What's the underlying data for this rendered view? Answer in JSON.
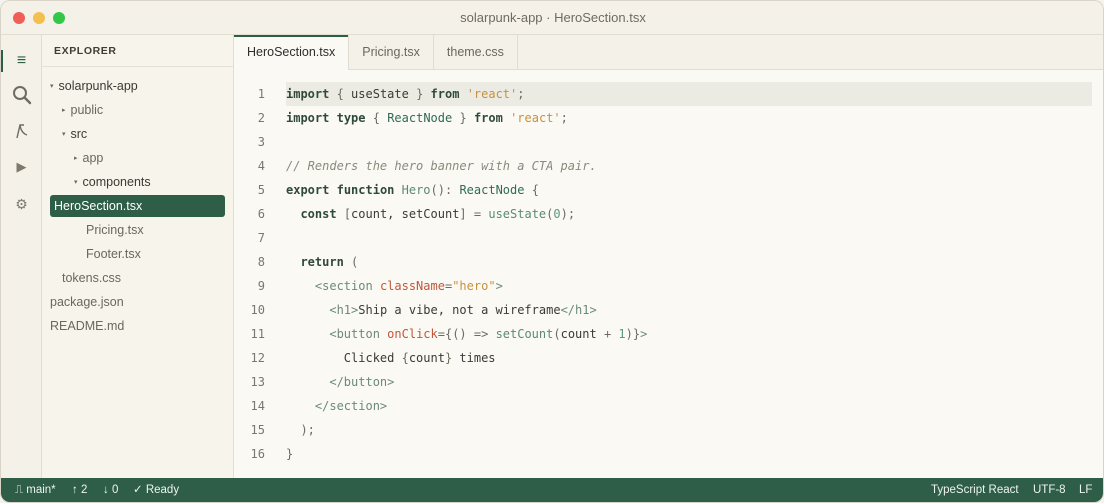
{
  "window": {
    "title": "solarpunk-app · HeroSection.tsx"
  },
  "activity_bar": {
    "icons": [
      {
        "name": "explorer-icon",
        "glyph": "≡",
        "active": true
      },
      {
        "name": "search-icon",
        "glyph": "🔍",
        "active": false
      },
      {
        "name": "source-control-icon",
        "glyph": "⎍",
        "active": false
      },
      {
        "name": "run-icon",
        "glyph": "▶",
        "active": false
      },
      {
        "name": "settings-icon",
        "glyph": "⚙",
        "active": false
      }
    ]
  },
  "sidebar": {
    "header": "EXPLORER",
    "items": [
      {
        "label": "solarpunk-app",
        "caret": "▾"
      },
      {
        "label": "public",
        "caret": "▸"
      },
      {
        "label": "src",
        "caret": "▾"
      },
      {
        "label": "app",
        "caret": "▸"
      },
      {
        "label": "components",
        "caret": "▾"
      },
      {
        "label": "HeroSection.tsx"
      },
      {
        "label": "Pricing.tsx"
      },
      {
        "label": "Footer.tsx"
      },
      {
        "label": "tokens.css"
      },
      {
        "label": "package.json"
      },
      {
        "label": "README.md"
      }
    ]
  },
  "tabs": [
    {
      "label": "HeroSection.tsx"
    },
    {
      "label": "Pricing.tsx"
    },
    {
      "label": "theme.css"
    }
  ],
  "editor": {
    "line_numbers": [
      "1",
      "2",
      "3",
      "4",
      "5",
      "6",
      "7",
      "8",
      "9",
      "10",
      "11",
      "12",
      "13",
      "14",
      "15",
      "16"
    ]
  },
  "statusbar": {
    "branch": "⎍ main*",
    "ahead": "↑ 2",
    "behind": "↓ 0",
    "ready": "✓ Ready",
    "language": "TypeScript React",
    "encoding": "UTF-8",
    "eol": "LF"
  },
  "colors": {
    "accent": "#2e5e48",
    "string": "#c8913c",
    "attribute": "#c0573b"
  }
}
